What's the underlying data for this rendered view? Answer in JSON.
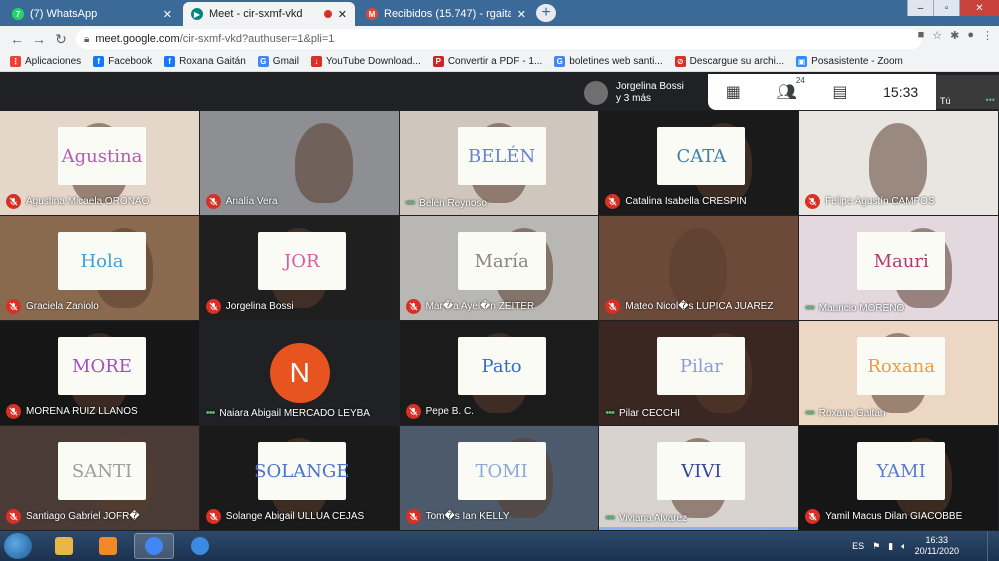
{
  "browser": {
    "tabs": [
      {
        "title": "(7) WhatsApp",
        "icon": "whatsapp-icon",
        "color": "#25d366",
        "glyph": "7",
        "active": false
      },
      {
        "title": "Meet - cir-sxmf-vkd",
        "icon": "google-meet-icon",
        "color": "#00897b",
        "glyph": "▶",
        "active": true
      },
      {
        "title": "Recibidos (15.747) - rgaitan@ho",
        "icon": "gmail-icon",
        "color": "#ea4335",
        "glyph": "M",
        "active": false
      }
    ],
    "newtab_label": "+",
    "url_host": "meet.google.com",
    "url_path": "/cir-sxmf-vkd?authuser=1&pli=1",
    "bookmarks": [
      {
        "label": "Aplicaciones",
        "icon": "apps-grid-icon",
        "color": "#ea4335",
        "glyph": "⋮"
      },
      {
        "label": "Facebook",
        "icon": "facebook-icon",
        "color": "#1877f2",
        "glyph": "f"
      },
      {
        "label": "Roxana Gaitán",
        "icon": "facebook-icon",
        "color": "#1877f2",
        "glyph": "f"
      },
      {
        "label": "Gmail",
        "icon": "google-icon",
        "color": "#4285f4",
        "glyph": "G"
      },
      {
        "label": "YouTube Download...",
        "icon": "youtube-download-icon",
        "color": "#d93025",
        "glyph": "↓"
      },
      {
        "label": "Convertir a PDF - 1...",
        "icon": "pdf-icon",
        "color": "#c62828",
        "glyph": "P"
      },
      {
        "label": "boletines web santi...",
        "icon": "google-icon",
        "color": "#4285f4",
        "glyph": "G"
      },
      {
        "label": "Descargue su archi...",
        "icon": "no-sign-icon",
        "color": "#d93025",
        "glyph": "⊘"
      },
      {
        "label": "Posasistente - Zoom",
        "icon": "zoom-icon",
        "color": "#2d8cff",
        "glyph": "▣"
      }
    ]
  },
  "meet": {
    "presenter": {
      "line1": "Jorgelina Bossi",
      "line2": "y 3 más"
    },
    "participants_count": "24",
    "clock": "15:33",
    "self_label": "Tú",
    "participants": [
      {
        "name": "Agustina Micaela ORONAO",
        "state": "muted",
        "bg": "#e4d6c9",
        "sign": "Agustina",
        "sign_color": "#b35bb5"
      },
      {
        "name": "Analía Vera",
        "state": "muted",
        "bg": "#8d8f92",
        "sign": "",
        "sign_color": ""
      },
      {
        "name": "Belén Reynoso",
        "state": "speaking",
        "bg": "#cfc6bd",
        "sign": "BELÉN",
        "sign_color": "#6a7fd6"
      },
      {
        "name": "Catalina Isabella CRESPIN",
        "state": "muted",
        "bg": "#1a1a1a",
        "sign": "CATA",
        "sign_color": "#3b7fb0"
      },
      {
        "name": "Felipe Agustín CAMPOS",
        "state": "muted",
        "bg": "#e9e6e1",
        "sign": "",
        "sign_color": ""
      },
      {
        "name": "Graciela Zaniolo",
        "state": "muted",
        "bg": "#8a6a4f",
        "sign": "Hola",
        "sign_color": "#3aa0d8"
      },
      {
        "name": "Jorgelina Bossi",
        "state": "muted",
        "bg": "#1f1f1f",
        "sign": "JOR",
        "sign_color": "#d55da0"
      },
      {
        "name": "Mar�a Ayel�n ZEITER",
        "state": "muted",
        "bg": "#b9b7b3",
        "sign": "María",
        "sign_color": "#8a8580"
      },
      {
        "name": "Mateo Nicol�s LUPICA JUAREZ",
        "state": "muted",
        "bg": "#6b4a3a",
        "sign": "",
        "sign_color": ""
      },
      {
        "name": "Mauricio MORENO",
        "state": "speaking",
        "bg": "#e2d8de",
        "sign": "Mauri",
        "sign_color": "#b23a6a"
      },
      {
        "name": "MORENA RUIZ LLANOS",
        "state": "muted",
        "bg": "#161616",
        "sign": "MORE",
        "sign_color": "#a64dc2"
      },
      {
        "name": "Naiara Abigail MERCADO LEYBA",
        "state": "speaking",
        "bg": "#202124",
        "sign": "",
        "sign_color": "",
        "initial": "N"
      },
      {
        "name": "Pepe B. C.",
        "state": "muted",
        "bg": "#1b1b1b",
        "sign": "Pato",
        "sign_color": "#2f6bd8"
      },
      {
        "name": "Pilar CECCHI",
        "state": "speaking",
        "bg": "#3a2721",
        "sign": "Pilar",
        "sign_color": "#8a9cd8"
      },
      {
        "name": "Roxana Gaitán",
        "state": "speaking",
        "bg": "#ecd7c4",
        "sign": "Roxana",
        "sign_color": "#f29a3a"
      },
      {
        "name": "Santiago Gabriel JOFR�",
        "state": "muted",
        "bg": "#4a3b36",
        "sign": "SANTI",
        "sign_color": "#9d9d9d"
      },
      {
        "name": "Solange Abigail ULLUA CEJAS",
        "state": "muted",
        "bg": "#1a1a1a",
        "sign": "SOLANGE",
        "sign_color": "#4a73c9"
      },
      {
        "name": "Tom�s Ian KELLY",
        "state": "muted",
        "bg": "#4d5a6b",
        "sign": "TOMI",
        "sign_color": "#8aaad6"
      },
      {
        "name": "Viviana Alvarez",
        "state": "speaking",
        "bg": "#d8d3cf",
        "sign": "VIVI",
        "sign_color": "#34489a",
        "active": true
      },
      {
        "name": "Yamil Macus Dilan GIACOBBE",
        "state": "muted",
        "bg": "#161616",
        "sign": "YAMI",
        "sign_color": "#5a7ad0"
      }
    ]
  },
  "taskbar": {
    "apps": [
      {
        "name": "file-explorer-icon",
        "color": "#e8b64a"
      },
      {
        "name": "media-player-icon",
        "color": "#f08a24"
      },
      {
        "name": "chrome-icon",
        "color": "#4285f4"
      },
      {
        "name": "internet-explorer-icon",
        "color": "#3c8be0"
      }
    ],
    "language": "ES",
    "time": "16:33",
    "date": "20/11/2020"
  }
}
